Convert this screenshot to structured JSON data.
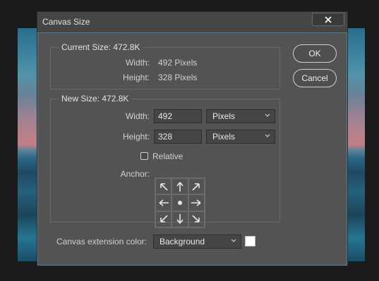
{
  "dialog": {
    "title": "Canvas Size",
    "close_icon": "close-icon"
  },
  "current_size": {
    "legend": "Current Size: 472.8K",
    "width_label": "Width:",
    "width_value": "492 Pixels",
    "height_label": "Height:",
    "height_value": "328 Pixels"
  },
  "new_size": {
    "legend": "New Size: 472.8K",
    "width_label": "Width:",
    "width_value": "492",
    "width_unit": "Pixels",
    "height_label": "Height:",
    "height_value": "328",
    "height_unit": "Pixels",
    "relative_label": "Relative",
    "relative_checked": false,
    "anchor_label": "Anchor:",
    "anchor_cells": [
      "arrow-up-left-icon",
      "arrow-up-icon",
      "arrow-up-right-icon",
      "arrow-left-icon",
      "anchor-center-dot-icon",
      "arrow-right-icon",
      "arrow-down-left-icon",
      "arrow-down-icon",
      "arrow-down-right-icon"
    ]
  },
  "extension": {
    "label": "Canvas extension color:",
    "value": "Background",
    "swatch_color": "#ffffff"
  },
  "buttons": {
    "ok": "OK",
    "cancel": "Cancel"
  },
  "colors": {
    "dialog_bg": "#535353",
    "titlebar_bg": "#464646",
    "input_bg": "#454545",
    "text": "#d0d0d0"
  }
}
